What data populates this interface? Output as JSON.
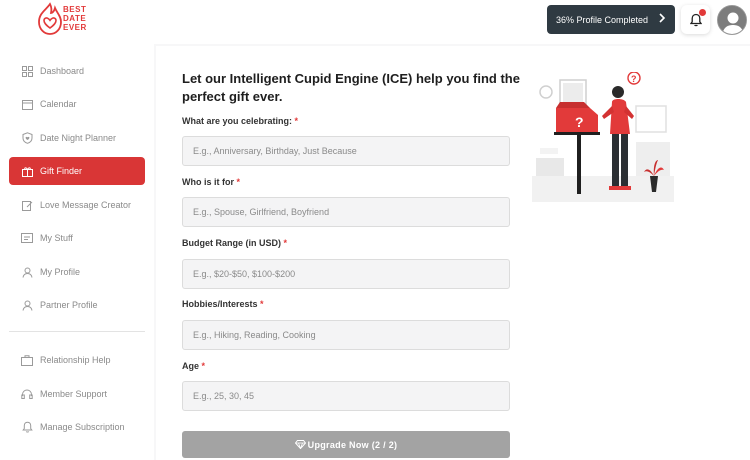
{
  "brand": {
    "logo_text_1": "BEST",
    "logo_text_2": "DATE",
    "logo_text_3": "EVER",
    "accent": "#e23a3a"
  },
  "header": {
    "profile_status": "36% Profile Completed",
    "notification_indicator": "unread"
  },
  "sidebar": {
    "items": [
      {
        "label": "Dashboard",
        "icon": "dashboard-icon"
      },
      {
        "label": "Calendar",
        "icon": "calendar-icon"
      },
      {
        "label": "Date Night Planner",
        "icon": "shield-icon"
      },
      {
        "label": "Gift Finder",
        "icon": "gift-icon",
        "active": true
      },
      {
        "label": "Love Message Creator",
        "icon": "edit-icon"
      },
      {
        "label": "My Stuff",
        "icon": "folder-icon"
      },
      {
        "label": "My Profile",
        "icon": "user-icon"
      },
      {
        "label": "Partner Profile",
        "icon": "partner-icon"
      }
    ],
    "support_items": [
      {
        "label": "Relationship Help",
        "icon": "help-icon"
      },
      {
        "label": "Member Support",
        "icon": "headset-icon"
      },
      {
        "label": "Manage Subscription",
        "icon": "bell-icon"
      }
    ]
  },
  "main": {
    "title": "Let our Intelligent Cupid Engine (ICE) help you find the perfect gift ever.",
    "fields": [
      {
        "label": "What are you celebrating:",
        "placeholder": "E.g., Anniversary, Birthday, Just Because",
        "value": ""
      },
      {
        "label": "Who is it for",
        "placeholder": "E.g., Spouse, Girlfriend, Boyfriend",
        "value": ""
      },
      {
        "label": "Budget Range (in USD)",
        "placeholder": "E.g., $20-$50, $100-$200",
        "value": ""
      },
      {
        "label": "Hobbies/Interests",
        "placeholder": "E.g., Hiking, Reading, Cooking",
        "value": ""
      },
      {
        "label": "Age",
        "placeholder": "E.g., 25, 30, 45",
        "value": ""
      }
    ],
    "required_mark": "*",
    "submit_label": "Upgrade Now (2 / 2)"
  }
}
